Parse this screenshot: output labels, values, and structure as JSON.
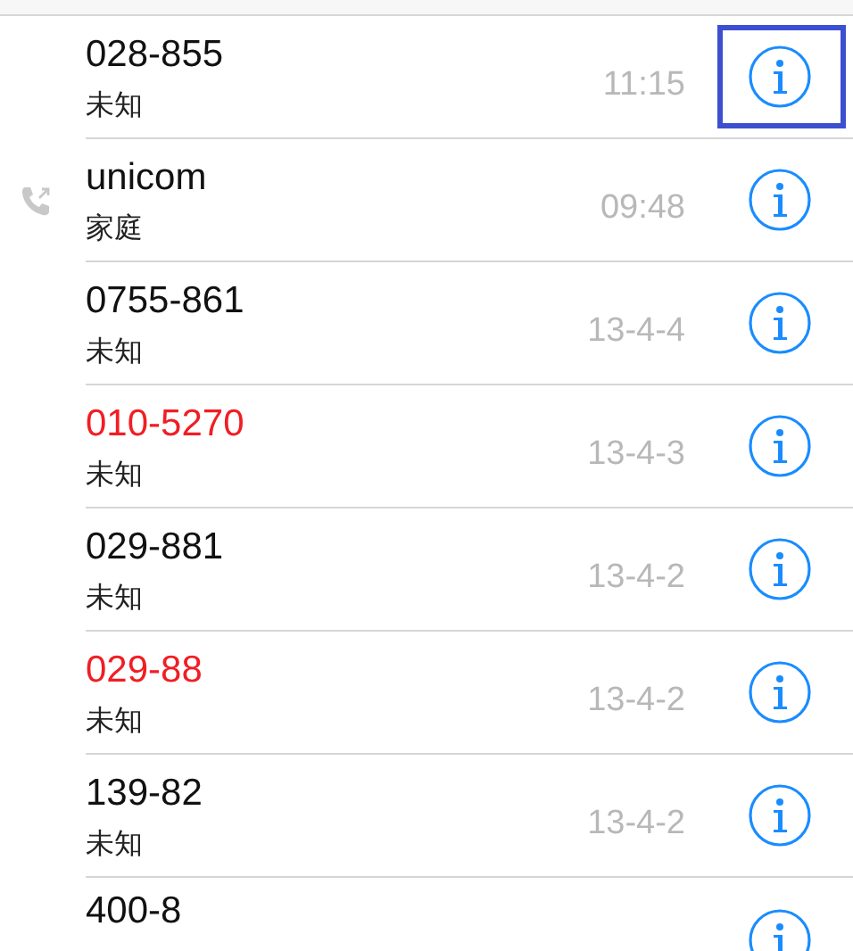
{
  "calls": [
    {
      "name": "028-855",
      "label": "未知",
      "time": "11:15",
      "missed": false,
      "outgoing": false,
      "highlighted": true
    },
    {
      "name": "unicom",
      "label": "家庭",
      "time": "09:48",
      "missed": false,
      "outgoing": true,
      "highlighted": false
    },
    {
      "name": "0755-861",
      "label": "未知",
      "time": "13-4-4",
      "missed": false,
      "outgoing": false,
      "highlighted": false
    },
    {
      "name": "010-5270",
      "label": "未知",
      "time": "13-4-3",
      "missed": true,
      "outgoing": false,
      "highlighted": false
    },
    {
      "name": "029-881",
      "label": "未知",
      "time": "13-4-2",
      "missed": false,
      "outgoing": false,
      "highlighted": false
    },
    {
      "name": "029-88",
      "label": "未知",
      "time": "13-4-2",
      "missed": true,
      "outgoing": false,
      "highlighted": false
    },
    {
      "name": "139-82",
      "label": "未知",
      "time": "13-4-2",
      "missed": false,
      "outgoing": false,
      "highlighted": false
    },
    {
      "name": "400-8",
      "missed": false,
      "outgoing": false,
      "highlighted": false
    }
  ]
}
